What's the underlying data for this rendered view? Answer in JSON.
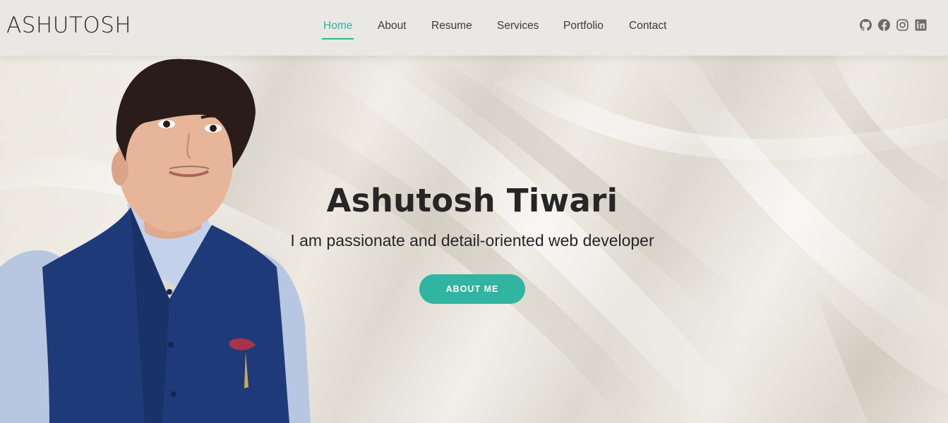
{
  "header": {
    "logo": "ASHUTOSH",
    "nav": [
      {
        "label": "Home",
        "active": true
      },
      {
        "label": "About",
        "active": false
      },
      {
        "label": "Resume",
        "active": false
      },
      {
        "label": "Services",
        "active": false
      },
      {
        "label": "Portfolio",
        "active": false
      },
      {
        "label": "Contact",
        "active": false
      }
    ],
    "socials": [
      "github-icon",
      "facebook-icon",
      "instagram-icon",
      "linkedin-icon"
    ]
  },
  "hero": {
    "name": "Ashutosh Tiwari",
    "tagline": "I am passionate and detail-oriented web developer",
    "button_label": "ABOUT ME",
    "portrait_alt": "portrait photo"
  },
  "colors": {
    "accent": "#2fb5a2",
    "header_bg": "#e9e8e5",
    "text": "#262626"
  }
}
